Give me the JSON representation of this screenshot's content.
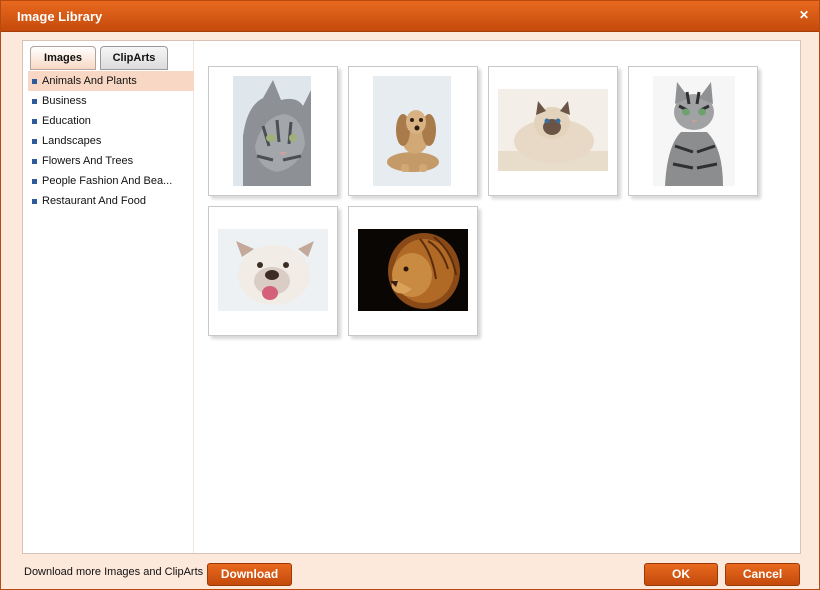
{
  "dialog": {
    "title": "Image Library",
    "close_icon": "close-icon"
  },
  "tabs": [
    {
      "label": "Images",
      "active": true
    },
    {
      "label": "ClipArts",
      "active": false
    }
  ],
  "categories": [
    {
      "label": "Animals And Plants",
      "selected": true
    },
    {
      "label": "Business",
      "selected": false
    },
    {
      "label": "Education",
      "selected": false
    },
    {
      "label": "Landscapes",
      "selected": false
    },
    {
      "label": "Flowers And Trees",
      "selected": false
    },
    {
      "label": "People Fashion And Bea...",
      "selected": false
    },
    {
      "label": "Restaurant And Food",
      "selected": false
    }
  ],
  "thumbnails": [
    {
      "subject": "kitten"
    },
    {
      "subject": "puppy"
    },
    {
      "subject": "persian-cat"
    },
    {
      "subject": "tabby-cat"
    },
    {
      "subject": "bulldog"
    },
    {
      "subject": "lion"
    }
  ],
  "footer": {
    "download_text": "Download more Images and ClipArts",
    "download_button": "Download",
    "ok_button": "OK",
    "cancel_button": "Cancel"
  },
  "colors": {
    "accent": "#d65a14",
    "selected_row": "#f8d8c4",
    "background": "#fde8dc"
  }
}
